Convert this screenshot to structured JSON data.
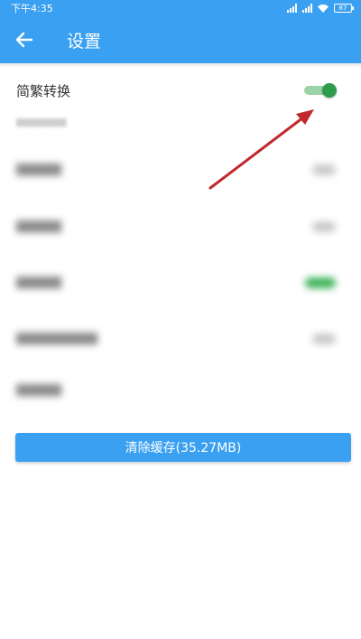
{
  "status_bar": {
    "time": "下午4:35",
    "battery": "87"
  },
  "app_bar": {
    "title": "设置",
    "back_icon": "arrow-left-icon"
  },
  "settings": {
    "main_item": {
      "label": "简繁转换",
      "enabled": true
    },
    "hint": "",
    "blurred_items": [
      {
        "label": "",
        "enabled": false
      },
      {
        "label": "",
        "enabled": false
      },
      {
        "label": "",
        "enabled": true
      },
      {
        "label": "",
        "enabled": false
      },
      {
        "label": ""
      }
    ]
  },
  "clear_cache_button": {
    "label": "清除缓存(35.27MB)"
  },
  "colors": {
    "primary": "#3aa0f2",
    "switch_on": "#2e9c4a",
    "annotation_arrow": "#c0282d"
  }
}
